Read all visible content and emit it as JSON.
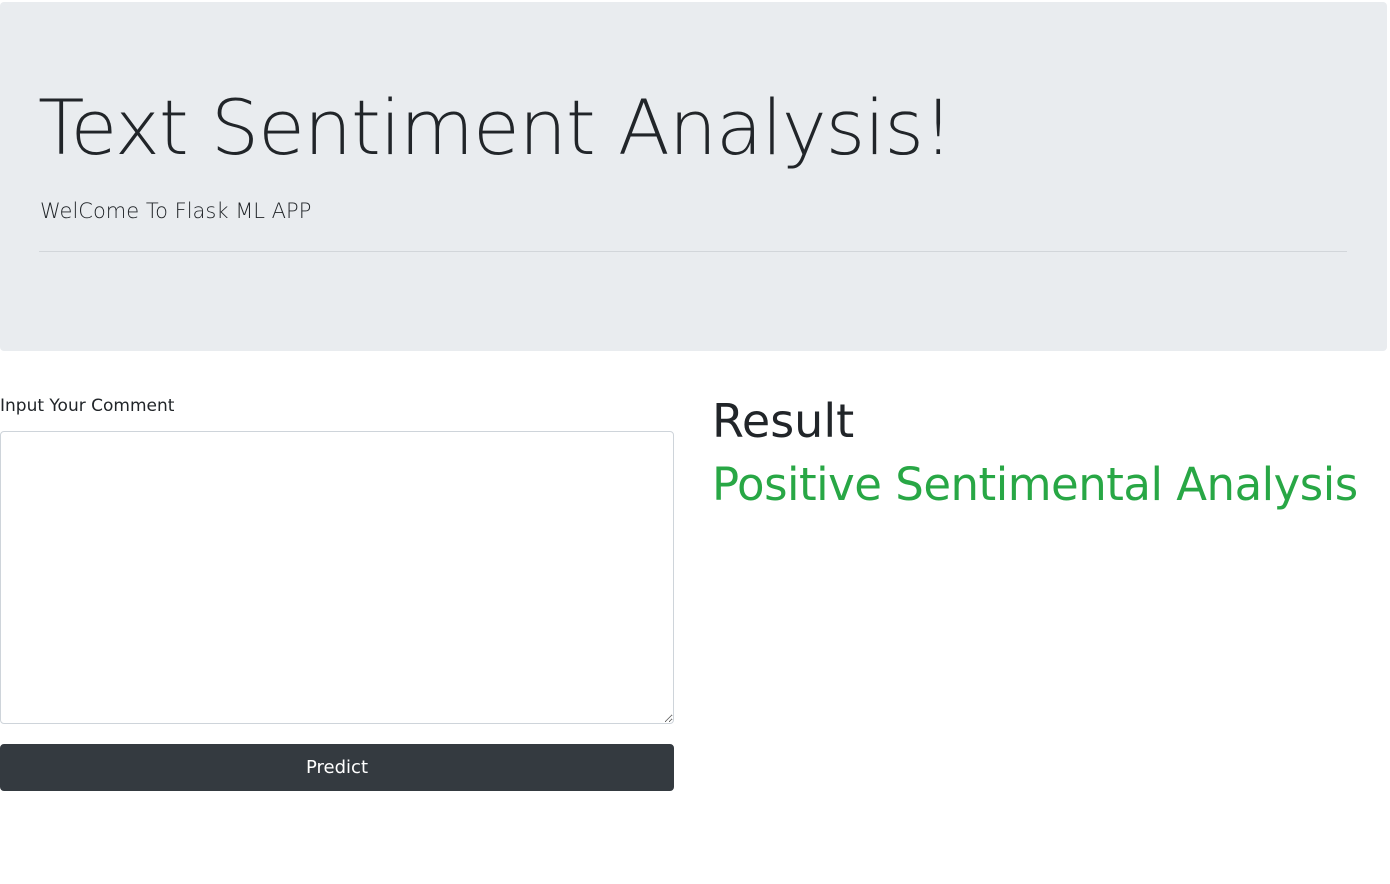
{
  "header": {
    "title": "Text Sentiment Analysis!",
    "subtitle": "WelCome To Flask ML APP"
  },
  "form": {
    "comment_label": "Input Your Comment",
    "comment_value": "",
    "predict_label": "Predict"
  },
  "result": {
    "heading": "Result",
    "prediction": "Positive Sentimental Analysis",
    "prediction_color": "#28a745"
  },
  "colors": {
    "jumbotron_bg": "#e9ecef",
    "button_bg": "#343a40",
    "text": "#212529"
  }
}
